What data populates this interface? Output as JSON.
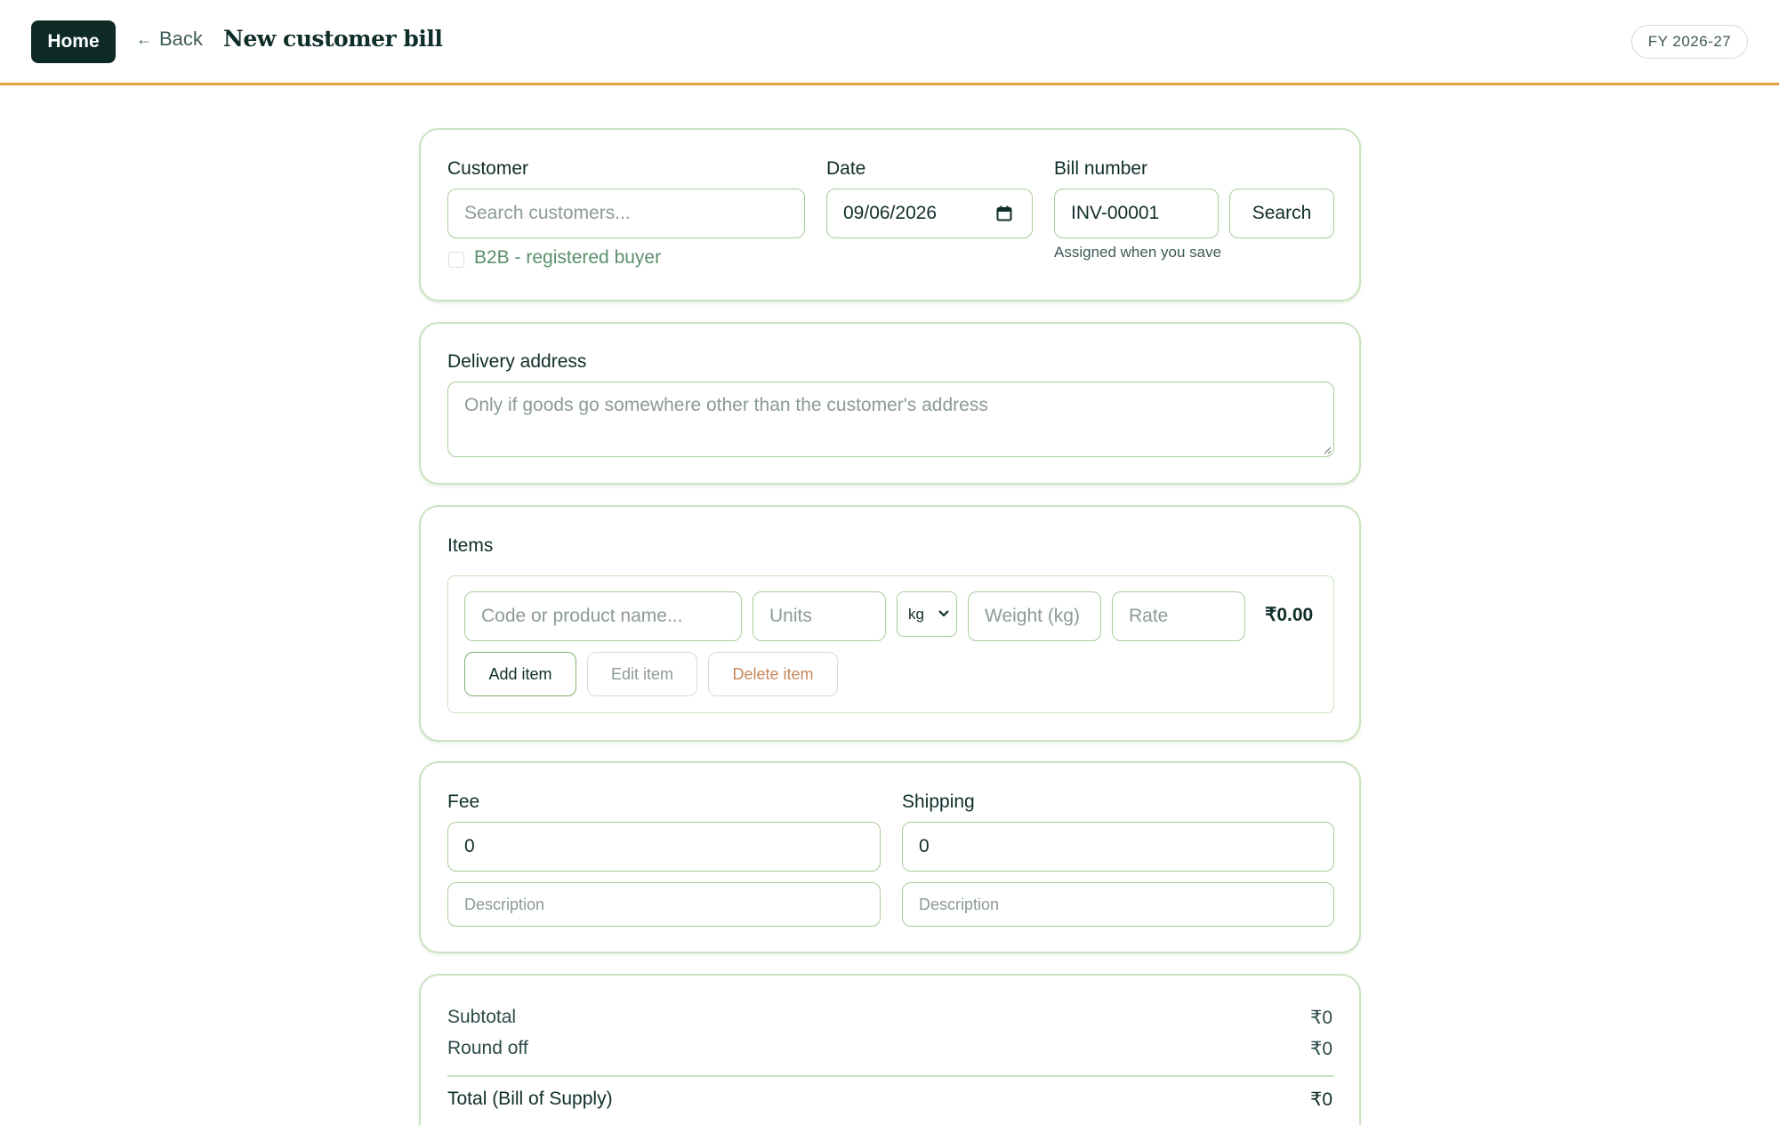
{
  "header": {
    "home_label": "Home",
    "back_label": "Back",
    "title": "New customer bill",
    "fiscal_year": "FY 2026-27"
  },
  "bill_info": {
    "customer_label": "Customer",
    "customer_placeholder": "Search customers...",
    "b2b_label": "B2B - registered buyer",
    "b2b_checked": false,
    "date_label": "Date",
    "date_value": "09/06/2026",
    "bill_number_label": "Bill number",
    "bill_number_value": "INV-00001",
    "search_label": "Search",
    "bill_number_hint": "Assigned when you save"
  },
  "delivery": {
    "label": "Delivery address",
    "placeholder": "Only if goods go somewhere other than the customer's address"
  },
  "items": {
    "label": "Items",
    "product_placeholder": "Code or product name...",
    "units_placeholder": "Units",
    "unit_select_value": "kg",
    "weight_placeholder": "Weight (kg)",
    "rate_placeholder": "Rate",
    "line_amount": "₹0.00",
    "add_label": "Add item",
    "edit_label": "Edit item",
    "delete_label": "Delete item"
  },
  "charges": {
    "fee_label": "Fee",
    "fee_value": "0",
    "fee_desc_placeholder": "Description",
    "shipping_label": "Shipping",
    "shipping_value": "0",
    "shipping_desc_placeholder": "Description"
  },
  "summary": {
    "subtotal_label": "Subtotal",
    "subtotal_value": "₹0",
    "roundoff_label": "Round off",
    "roundoff_value": "₹0",
    "total_label": "Total (Bill of Supply)",
    "total_value": "₹0"
  },
  "colors": {
    "accent_dark": "#0e2a26",
    "border_green": "#a9cc9c",
    "header_rule": "#e2a03f",
    "delete_text": "#c8865a"
  }
}
